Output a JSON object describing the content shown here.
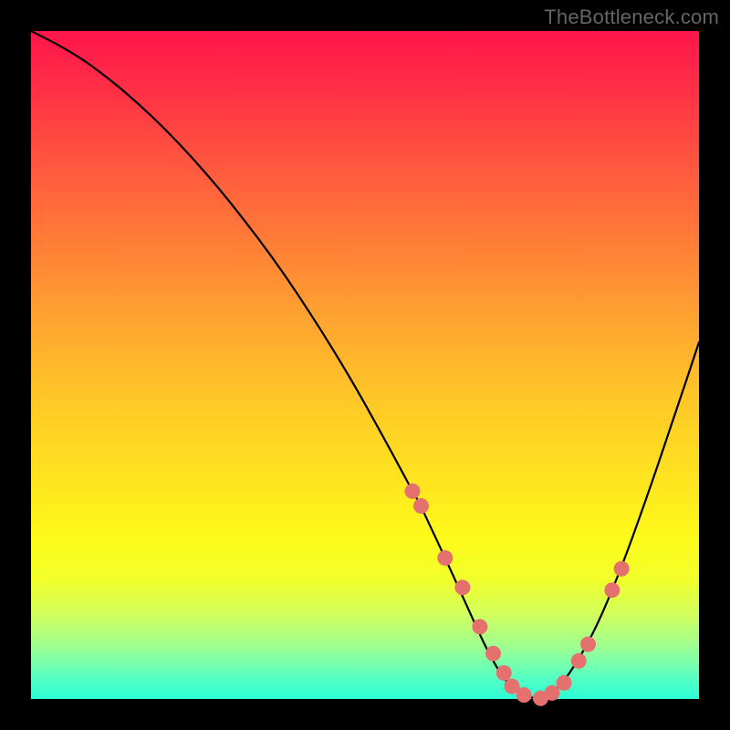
{
  "watermark": "TheBottleneck.com",
  "chart_data": {
    "type": "line",
    "title": "",
    "xlabel": "",
    "ylabel": "",
    "xlim": [
      0,
      100
    ],
    "ylim": [
      0,
      100
    ],
    "curve": {
      "x": [
        0,
        4,
        8,
        12,
        16,
        20,
        24,
        28,
        32,
        36,
        40,
        44,
        48,
        52,
        56,
        57,
        58,
        60,
        62,
        64,
        66,
        68,
        70,
        72,
        74,
        76,
        78,
        80,
        84,
        88,
        92,
        96,
        100
      ],
      "y": [
        100,
        98,
        95.6,
        92.6,
        89.2,
        85.4,
        81.2,
        76.6,
        71.6,
        66.3,
        60.5,
        54.3,
        47.7,
        40.6,
        33.2,
        31.3,
        29.6,
        25.4,
        21.1,
        16.7,
        12.3,
        7.9,
        4.2,
        1.6,
        0.3,
        0.1,
        0.9,
        2.8,
        9.3,
        18.6,
        29.6,
        41.4,
        53.4
      ]
    },
    "markers": {
      "x": [
        57.1,
        58.4,
        62.0,
        64.6,
        67.2,
        69.2,
        70.8,
        72.0,
        73.8,
        76.3,
        78.0,
        79.8,
        82.0,
        83.4,
        87.0,
        88.4
      ],
      "y": [
        31.1,
        28.9,
        21.1,
        16.7,
        10.8,
        6.8,
        3.9,
        1.9,
        0.6,
        0.1,
        0.9,
        2.4,
        5.7,
        8.2,
        16.3,
        19.5
      ]
    },
    "marker_color": "#e4716e",
    "line_color": "#000000"
  }
}
